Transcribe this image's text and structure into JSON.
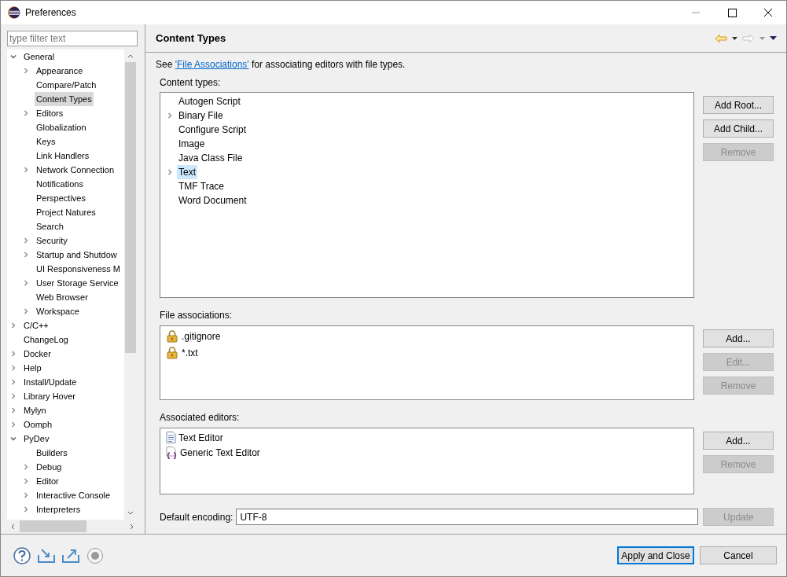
{
  "window": {
    "title": "Preferences"
  },
  "sidebar": {
    "filter_placeholder": "type filter text",
    "tree": [
      {
        "label": "General",
        "expandable": true,
        "expanded": true,
        "selected": false,
        "children": [
          {
            "label": "Appearance",
            "expandable": true,
            "expanded": false,
            "selected": false
          },
          {
            "label": "Compare/Patch",
            "expandable": false,
            "expanded": false,
            "selected": false
          },
          {
            "label": "Content Types",
            "expandable": false,
            "expanded": false,
            "selected": true
          },
          {
            "label": "Editors",
            "expandable": true,
            "expanded": false,
            "selected": false
          },
          {
            "label": "Globalization",
            "expandable": false,
            "expanded": false,
            "selected": false
          },
          {
            "label": "Keys",
            "expandable": false,
            "expanded": false,
            "selected": false
          },
          {
            "label": "Link Handlers",
            "expandable": false,
            "expanded": false,
            "selected": false
          },
          {
            "label": "Network Connection",
            "expandable": true,
            "expanded": false,
            "selected": false
          },
          {
            "label": "Notifications",
            "expandable": false,
            "expanded": false,
            "selected": false
          },
          {
            "label": "Perspectives",
            "expandable": false,
            "expanded": false,
            "selected": false
          },
          {
            "label": "Project Natures",
            "expandable": false,
            "expanded": false,
            "selected": false
          },
          {
            "label": "Search",
            "expandable": false,
            "expanded": false,
            "selected": false
          },
          {
            "label": "Security",
            "expandable": true,
            "expanded": false,
            "selected": false
          },
          {
            "label": "Startup and Shutdow",
            "expandable": true,
            "expanded": false,
            "selected": false
          },
          {
            "label": "UI Responsiveness M",
            "expandable": false,
            "expanded": false,
            "selected": false
          },
          {
            "label": "User Storage Service",
            "expandable": true,
            "expanded": false,
            "selected": false
          },
          {
            "label": "Web Browser",
            "expandable": false,
            "expanded": false,
            "selected": false
          },
          {
            "label": "Workspace",
            "expandable": true,
            "expanded": false,
            "selected": false
          }
        ]
      },
      {
        "label": "C/C++",
        "expandable": true,
        "expanded": false,
        "selected": false
      },
      {
        "label": "ChangeLog",
        "expandable": false,
        "expanded": false,
        "selected": false
      },
      {
        "label": "Docker",
        "expandable": true,
        "expanded": false,
        "selected": false
      },
      {
        "label": "Help",
        "expandable": true,
        "expanded": false,
        "selected": false
      },
      {
        "label": "Install/Update",
        "expandable": true,
        "expanded": false,
        "selected": false
      },
      {
        "label": "Library Hover",
        "expandable": true,
        "expanded": false,
        "selected": false
      },
      {
        "label": "Mylyn",
        "expandable": true,
        "expanded": false,
        "selected": false
      },
      {
        "label": "Oomph",
        "expandable": true,
        "expanded": false,
        "selected": false
      },
      {
        "label": "PyDev",
        "expandable": true,
        "expanded": true,
        "selected": false,
        "children": [
          {
            "label": "Builders",
            "expandable": false,
            "expanded": false,
            "selected": false
          },
          {
            "label": "Debug",
            "expandable": true,
            "expanded": false,
            "selected": false
          },
          {
            "label": "Editor",
            "expandable": true,
            "expanded": false,
            "selected": false
          },
          {
            "label": "Interactive Console",
            "expandable": true,
            "expanded": false,
            "selected": false
          },
          {
            "label": "Interpreters",
            "expandable": true,
            "expanded": false,
            "selected": false
          }
        ]
      }
    ]
  },
  "page": {
    "title": "Content Types",
    "description": {
      "before": "See ",
      "link": "'File Associations'",
      "after": " for associating editors with file types."
    }
  },
  "content_types": {
    "label": "Content types:",
    "items": [
      {
        "label": "Autogen Script",
        "expandable": false,
        "selected": false
      },
      {
        "label": "Binary File",
        "expandable": true,
        "selected": false
      },
      {
        "label": "Configure Script",
        "expandable": false,
        "selected": false
      },
      {
        "label": "Image",
        "expandable": false,
        "selected": false
      },
      {
        "label": "Java Class File",
        "expandable": false,
        "selected": false
      },
      {
        "label": "Text",
        "expandable": true,
        "selected": true
      },
      {
        "label": "TMF Trace",
        "expandable": false,
        "selected": false
      },
      {
        "label": "Word Document",
        "expandable": false,
        "selected": false
      }
    ],
    "buttons": [
      {
        "label": "Add Root...",
        "disabled": false
      },
      {
        "label": "Add Child...",
        "disabled": false
      },
      {
        "label": "Remove",
        "disabled": true
      }
    ]
  },
  "file_associations": {
    "label": "File associations:",
    "items": [
      {
        "label": ".gitignore"
      },
      {
        "label": "*.txt"
      }
    ],
    "buttons": [
      {
        "label": "Add...",
        "disabled": false
      },
      {
        "label": "Edit...",
        "disabled": true
      },
      {
        "label": "Remove",
        "disabled": true
      }
    ]
  },
  "associated_editors": {
    "label": "Associated editors:",
    "items": [
      {
        "label": "Text Editor",
        "kind": "text"
      },
      {
        "label": "Generic Text Editor",
        "kind": "generic"
      }
    ],
    "buttons": [
      {
        "label": "Add...",
        "disabled": false
      },
      {
        "label": "Remove",
        "disabled": true
      }
    ]
  },
  "encoding": {
    "label": "Default encoding:",
    "value": "UTF-8",
    "button": {
      "label": "Update",
      "disabled": true
    }
  },
  "footer": {
    "buttons": [
      {
        "label": "Apply and Close",
        "default": true
      },
      {
        "label": "Cancel",
        "default": false
      }
    ]
  }
}
